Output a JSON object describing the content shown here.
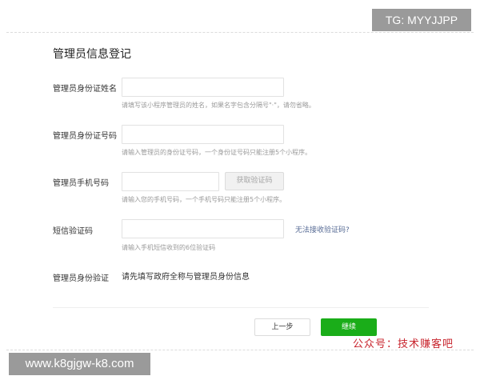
{
  "form": {
    "title": "管理员信息登记",
    "name": {
      "label": "管理员身份证姓名",
      "value": "",
      "hint": "请填写该小程序管理员的姓名，如果名字包含分隔号\"·\"，请勿省略。"
    },
    "id_number": {
      "label": "管理员身份证号码",
      "value": "",
      "hint": "请输入管理员的身份证号码，一个身份证号码只能注册5个小程序。"
    },
    "phone": {
      "label": "管理员手机号码",
      "value": "",
      "get_code_button": "获取验证码",
      "hint": "请输入您的手机号码，一个手机号码只能注册5个小程序。"
    },
    "sms_code": {
      "label": "短信验证码",
      "value": "",
      "cannot_receive_link": "无法接收验证码?",
      "hint": "请输入手机短信收到的6位验证码"
    },
    "identity_verify": {
      "label": "管理员身份验证",
      "text": "请先填写政府全称与管理员身份信息"
    },
    "prev_button": "上一步",
    "next_button": "继续"
  },
  "watermarks": {
    "tg": "TG: MYYJJPP",
    "url": "www.k8gjgw-k8.com",
    "public_account": "公众号：技术赚客吧"
  },
  "colors": {
    "primary_green": "#1aad19",
    "link_blue": "#576b95",
    "watermark_red": "#c8242d"
  }
}
